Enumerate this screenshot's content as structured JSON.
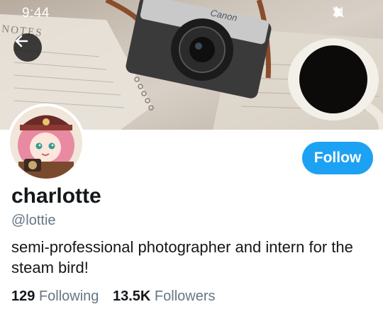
{
  "status_bar": {
    "time": "9:44"
  },
  "header": {
    "back_icon": "arrow-left-icon",
    "banner_text": "NOTES",
    "camera_brand": "Canon"
  },
  "profile": {
    "display_name": "charlotte",
    "handle": "@lottie",
    "bio": "semi-professional photographer and intern for the steam bird!",
    "follow_label": "Follow",
    "following_count": "129",
    "following_label": "Following",
    "followers_count": "13.5K",
    "followers_label": "Followers"
  },
  "colors": {
    "accent": "#1da1f2",
    "text_primary": "#14171a",
    "text_secondary": "#657786"
  }
}
